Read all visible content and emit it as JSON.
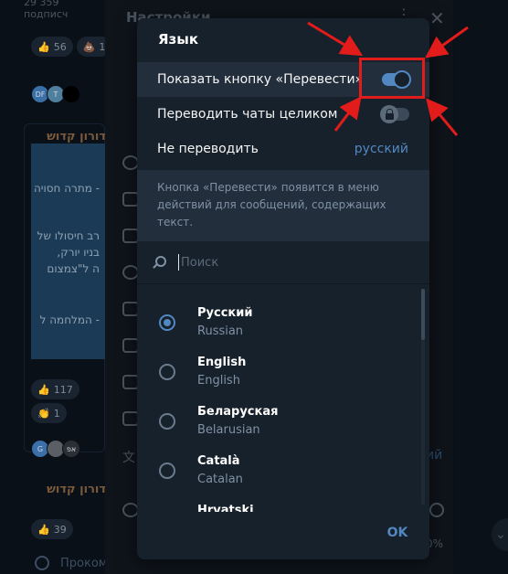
{
  "background": {
    "subscribers": "29 359 подписч",
    "reactions_top": [
      {
        "icon": "thumbs-up",
        "count": "56"
      },
      {
        "icon": "poop",
        "count": "1"
      }
    ],
    "avatars_top": [
      "DF",
      "T",
      ""
    ],
    "hebrew_title": "דורון קדוש",
    "hebrew_lines": [
      "- מתרה חסויה",
      "רב חיסולו של",
      "בניו יורק,",
      "ה ל\"צמצום",
      "- המלחמה ל"
    ],
    "reactions_mid": [
      {
        "icon": "thumbs-up",
        "count": "117"
      },
      {
        "icon": "vomit",
        "count": "1"
      },
      {
        "icon": "clap",
        "count": "1"
      },
      {
        "icon": "thinking",
        "count": "1"
      }
    ],
    "avatars_mid": [
      "G",
      "",
      "אפ"
    ],
    "hebrew_title_2": "דורון קדוש",
    "reactions_bottom": [
      {
        "icon": "thumbs-up",
        "count": "39"
      },
      {
        "icon": "vomit",
        "count": "1"
      }
    ],
    "poll_option": "Прокомм",
    "settings_title": "Настройки",
    "side_text_right": "ий",
    "side_pct": "0%"
  },
  "dialog": {
    "title": "Язык",
    "options": [
      {
        "label": "Показать кнопку «Перевести»",
        "toggle": "on"
      },
      {
        "label": "Переводить чаты целиком",
        "toggle": "locked"
      },
      {
        "label": "Не переводить",
        "value": "русский"
      }
    ],
    "info_text": "Кнопка «Перевести» появится в меню действий для сообщений, содержащих текст.",
    "search": {
      "placeholder": "Поиск",
      "value": ""
    },
    "languages": [
      {
        "name": "Русский",
        "native": "Russian",
        "selected": true
      },
      {
        "name": "English",
        "native": "English",
        "selected": false
      },
      {
        "name": "Беларуская",
        "native": "Belarusian",
        "selected": false
      },
      {
        "name": "Català",
        "native": "Catalan",
        "selected": false
      },
      {
        "name": "Hrvatski",
        "native": "",
        "selected": false
      }
    ],
    "ok_label": "OK"
  },
  "colors": {
    "accent": "#5288c1",
    "dialog_bg": "#17212b",
    "annotation": "#e21b1b"
  }
}
